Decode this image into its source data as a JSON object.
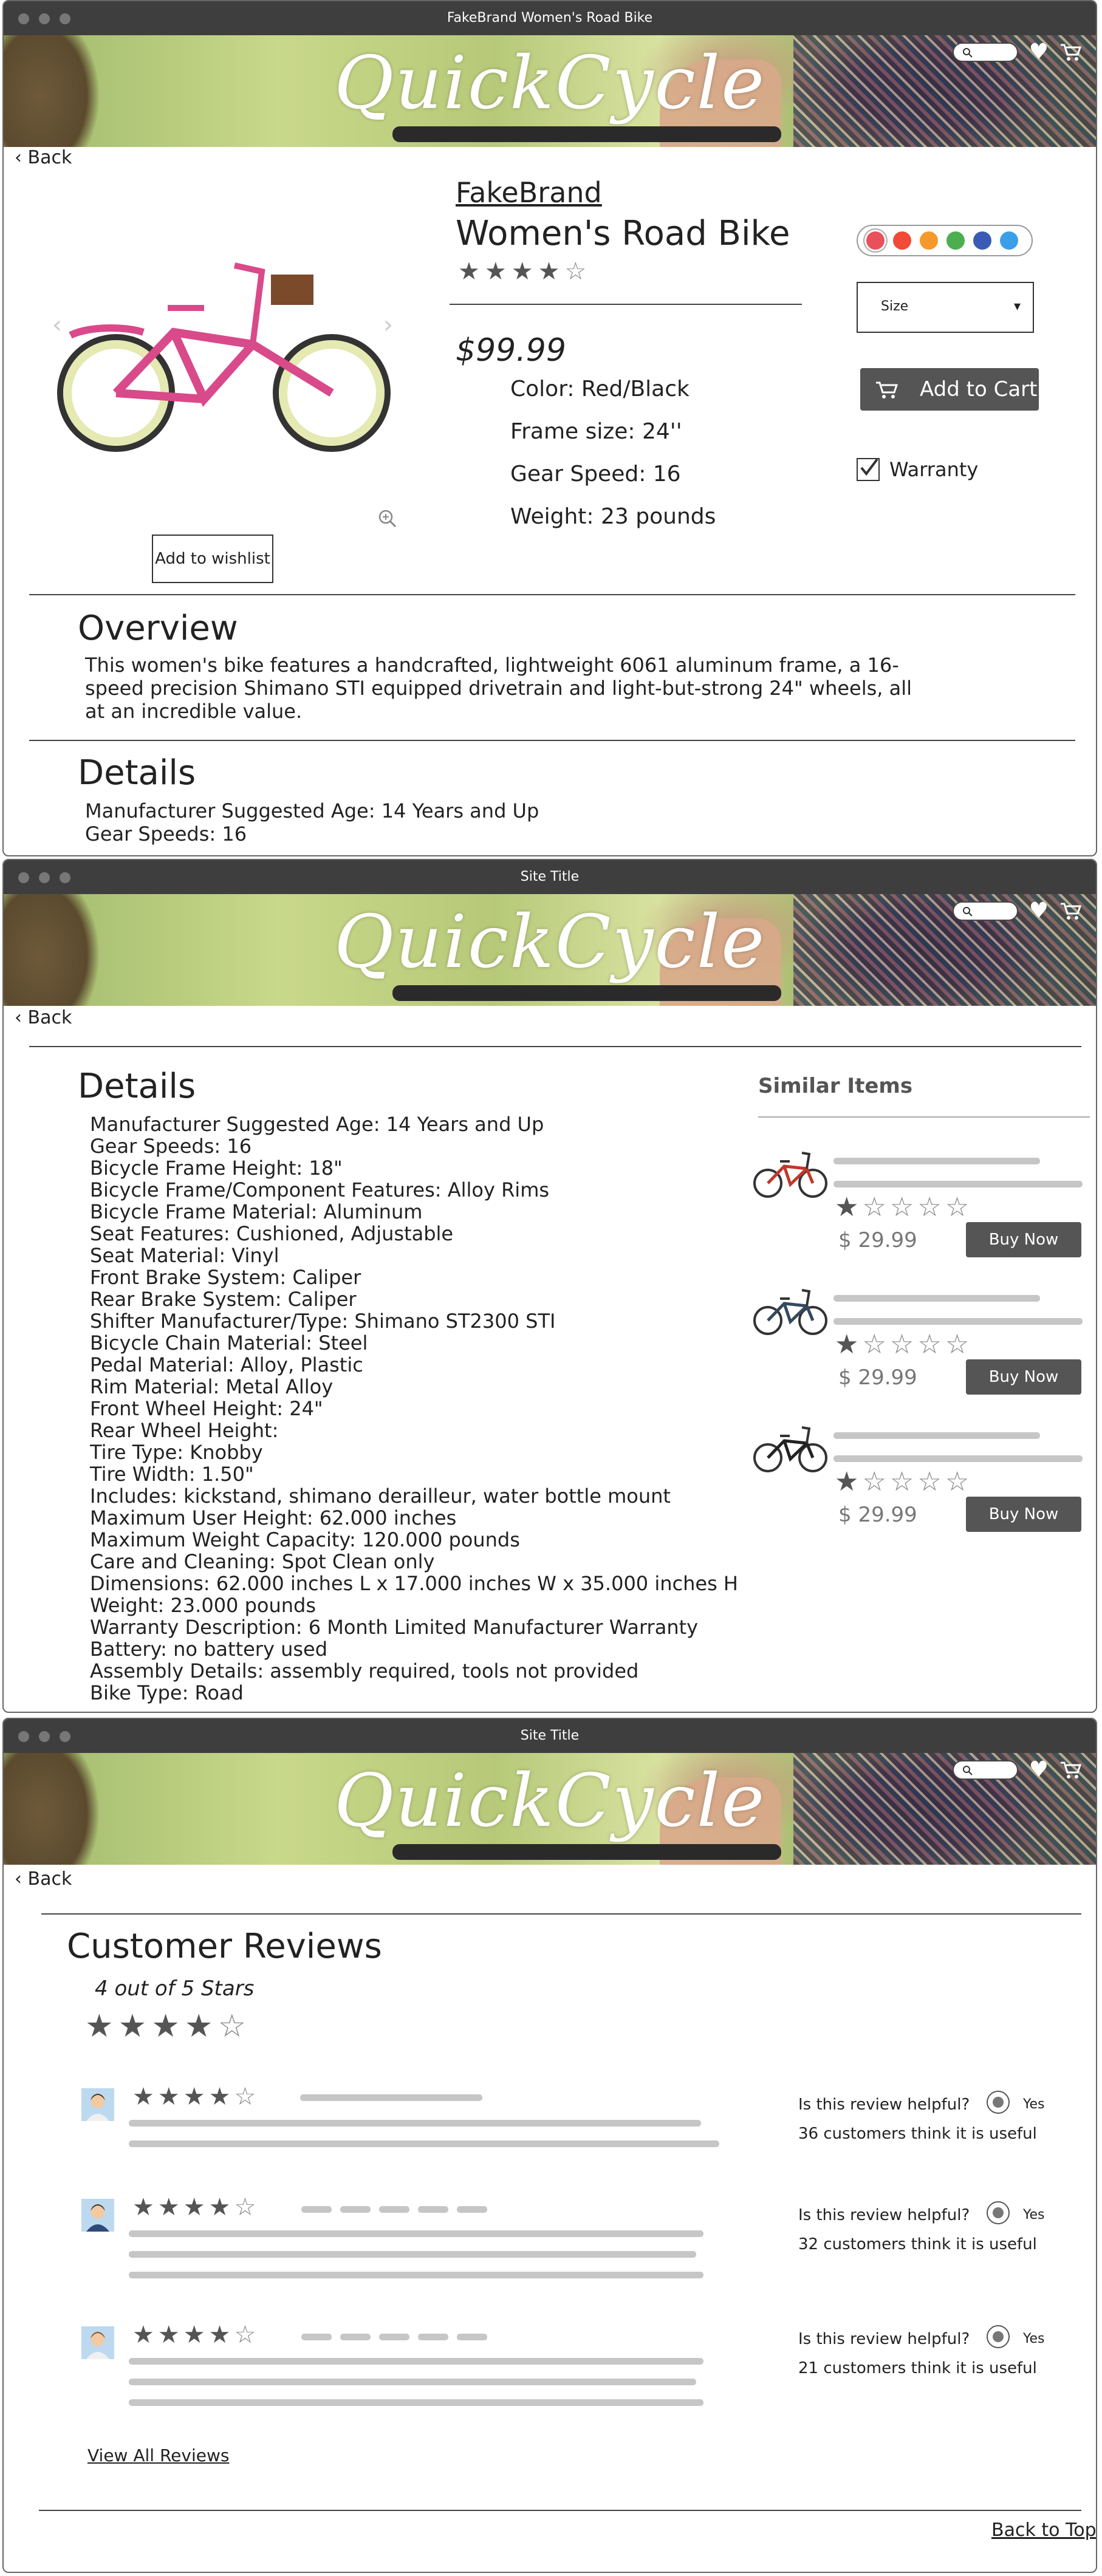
{
  "windows": [
    {
      "title": "FakeBrand Women's Road Bike"
    },
    {
      "title": "Site Title"
    },
    {
      "title": "Site Title"
    }
  ],
  "header": {
    "logo": "QuickCycle",
    "icons": [
      "search-icon",
      "heart-icon",
      "cart-icon"
    ],
    "back_label": "Back"
  },
  "product": {
    "brand": "FakeBrand",
    "name": "Women's Road Bike",
    "rating": 4,
    "rating_max": 5,
    "price": "$99.99",
    "specs": [
      "Color: Red/Black",
      "Frame size: 24''",
      "Gear Speed: 16",
      "Weight: 23 pounds"
    ],
    "wishlist_label": "Add to wishlist",
    "swatch_colors": [
      "#e8505b",
      "#f14a36",
      "#f59a2a",
      "#4cae4f",
      "#3a5bb5",
      "#3b9fe8"
    ],
    "size_label": "Size",
    "add_to_cart_label": "Add to Cart",
    "warranty_label": "Warranty",
    "warranty_checked": true
  },
  "overview": {
    "heading": "Overview",
    "lines": [
      "This women's bike features a handcrafted, lightweight 6061 aluminum frame, a 16-",
      "speed precision Shimano STI equipped drivetrain and light-but-strong 24\" wheels, all",
      "at an incredible value."
    ]
  },
  "details_short": {
    "heading": "Details",
    "lines": [
      "Manufacturer Suggested Age: 14 Years and Up",
      "Gear Speeds: 16"
    ]
  },
  "details_full": {
    "heading": "Details",
    "lines": [
      "Manufacturer Suggested Age: 14 Years and Up",
      "Gear Speeds: 16",
      "Bicycle Frame Height: 18\"",
      "Bicycle Frame/Component Features: Alloy Rims",
      "Bicycle Frame Material: Aluminum",
      "Seat Features: Cushioned, Adjustable",
      "Seat Material: Vinyl",
      "Front Brake System: Caliper",
      "Rear Brake System: Caliper",
      "Shifter Manufacturer/Type: Shimano ST2300 STI",
      "Bicycle Chain Material: Steel",
      "Pedal Material: Alloy, Plastic",
      "Rim Material: Metal Alloy",
      "Front Wheel Height: 24\"",
      "Rear Wheel Height:",
      "Tire Type: Knobby",
      "Tire Width: 1.50\"",
      "Includes: kickstand, shimano derailleur, water bottle mount",
      "Maximum User Height: 62.000 inches",
      "Maximum Weight Capacity: 120.000 pounds",
      "Care and Cleaning: Spot Clean only",
      "Dimensions: 62.000 inches L x 17.000 inches W x 35.000 inches H",
      "Weight: 23.000 pounds",
      "Warranty Description: 6 Month Limited Manufacturer Warranty",
      "Battery: no battery used",
      "Assembly Details: assembly required, tools not provided",
      "Bike Type: Road"
    ]
  },
  "similar": {
    "heading": "Similar Items",
    "items": [
      {
        "price": "$ 29.99",
        "rating": 1,
        "button": "Buy Now",
        "frame_color": "#c0392b"
      },
      {
        "price": "$ 29.99",
        "rating": 1,
        "button": "Buy Now",
        "frame_color": "#34495e"
      },
      {
        "price": "$ 29.99",
        "rating": 1,
        "button": "Buy Now",
        "frame_color": "#222222"
      }
    ]
  },
  "reviews": {
    "heading": "Customer Reviews",
    "summary": "4 out of 5 Stars",
    "rating": 4,
    "items": [
      {
        "rating": 4,
        "question": "Is this review helpful?",
        "yes": "Yes",
        "count": "36 customers think it is useful"
      },
      {
        "rating": 4,
        "question": "Is this review helpful?",
        "yes": "Yes",
        "count": "32 customers think it is useful"
      },
      {
        "rating": 4,
        "question": "Is this review helpful?",
        "yes": "Yes",
        "count": "21 customers think it is useful"
      }
    ],
    "view_all": "View All Reviews",
    "back_to_top": "Back to Top"
  }
}
